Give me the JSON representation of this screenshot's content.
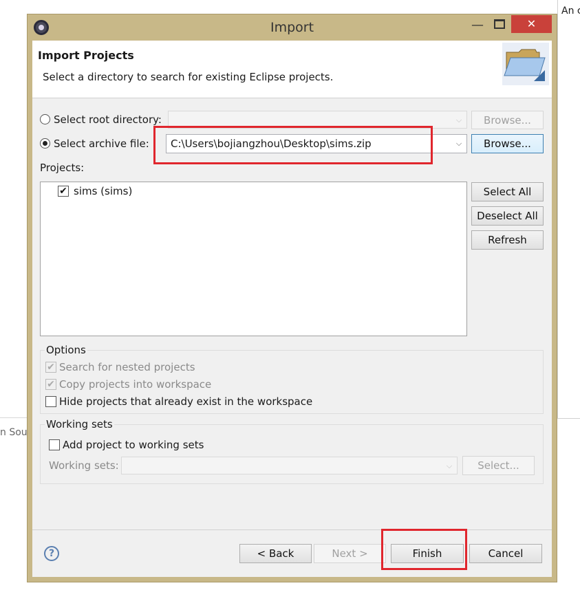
{
  "background": {
    "top_right_text": "An c",
    "left_text": "n Sour"
  },
  "dialog": {
    "title": "Import",
    "minimize_glyph": "—",
    "close_glyph": "✕"
  },
  "header": {
    "title": "Import Projects",
    "description": "Select a directory to search for existing Eclipse projects."
  },
  "source": {
    "root_directory_label": "Select root directory:",
    "root_directory_value": "",
    "archive_label": "Select archive file:",
    "archive_value": "C:\\Users\\bojiangzhou\\Desktop\\sims.zip",
    "browse_label": "Browse...",
    "selected": "archive"
  },
  "projects": {
    "label": "Projects:",
    "items": [
      {
        "label": "sims (sims)",
        "checked": true
      }
    ],
    "select_all": "Select All",
    "deselect_all": "Deselect All",
    "refresh": "Refresh"
  },
  "options": {
    "title": "Options",
    "nested": "Search for nested projects",
    "copy": "Copy projects into workspace",
    "hide": "Hide projects that already exist in the workspace"
  },
  "working_sets": {
    "title": "Working sets",
    "add_label": "Add project to working sets",
    "sets_label": "Working sets:",
    "sets_value": "",
    "select_button": "Select..."
  },
  "footer": {
    "help": "?",
    "back": "< Back",
    "next": "Next >",
    "finish": "Finish",
    "cancel": "Cancel"
  },
  "icons": {
    "app": "eclipse-icon",
    "folder": "open-folder-icon",
    "dropdown": "chevron-down-icon",
    "check": "✔"
  },
  "colors": {
    "title_bar": "#c8b888",
    "close_button": "#c9413a",
    "highlight": "#e0262d"
  }
}
